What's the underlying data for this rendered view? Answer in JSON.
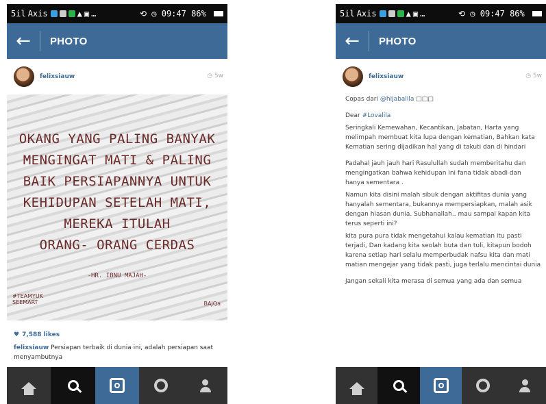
{
  "left": {
    "status": {
      "carrier": "Axis",
      "time": "09:47",
      "battery": "86%"
    },
    "appbar": {
      "title": "PHOTO"
    },
    "post": {
      "username": "felixsiauw",
      "time_ago": "5w",
      "quote_lines": [
        "OKANG YANG PALING BANYAK",
        "MENGINGAT MATI & PALING",
        "BAIK PERSIAPANNYA UNTUK",
        "KEHIDUPAN SETELAH MATI,",
        "MEREKA ITULAH",
        "ORANG- ORANG CERDAS"
      ],
      "quote_author": "-HR. IBNU MAJAH-",
      "watermark_left": "#TEAMYUK\nSEEMART",
      "watermark_right": "BAJQa",
      "likes": "7,588 likes",
      "caption_user": "felixsiauw",
      "caption_text": "Persiapan terbaik di dunia ini, adalah persiapan saat menyambutnya"
    }
  },
  "right": {
    "status": {
      "carrier": "Axis",
      "time": "09:47",
      "battery": "86%"
    },
    "appbar": {
      "title": "PHOTO"
    },
    "post": {
      "username": "felixsiauw",
      "time_ago": "5w"
    },
    "caption": {
      "repost_prefix": "Copas dari",
      "repost_mention": "@hijabalila",
      "repost_suffix": "□□□",
      "dear_prefix": "Dear",
      "dear_mention": "#Lovalila",
      "p1": "Seringkali Kemewahan, Kecantikan, Jabatan, Harta yang melimpah membuat kita lupa dengan kematian, Bahkan kata Kematian sering dijadikan hal yang di takuti dan di hindari",
      "p2": "Padahal jauh jauh hari Rasulullah sudah memberitahu dan mengingatkan bahwa kehidupan ini fana tidak abadi dan hanya sementara .",
      "p3": "Namun kita disini malah sibuk dengan aktifitas dunia yang hanyalah sementara, bukannya mempersiapkan, malah asik dengan hiasan dunia. Subhanallah.. mau sampai kapan kita terus seperti ini?",
      "p4": "kita pura pura tidak mengetahui kalau kematian itu pasti terjadi, Dan kadang kita seolah buta dan tuli, kitapun bodoh karena setiap hari selalu memperbudak nafsu kita dan mati matian mengejar yang tidak pasti, juga terlalu mencintai dunia",
      "p5": "Jangan sekali kita merasa di semua yang ada dan semua"
    }
  }
}
